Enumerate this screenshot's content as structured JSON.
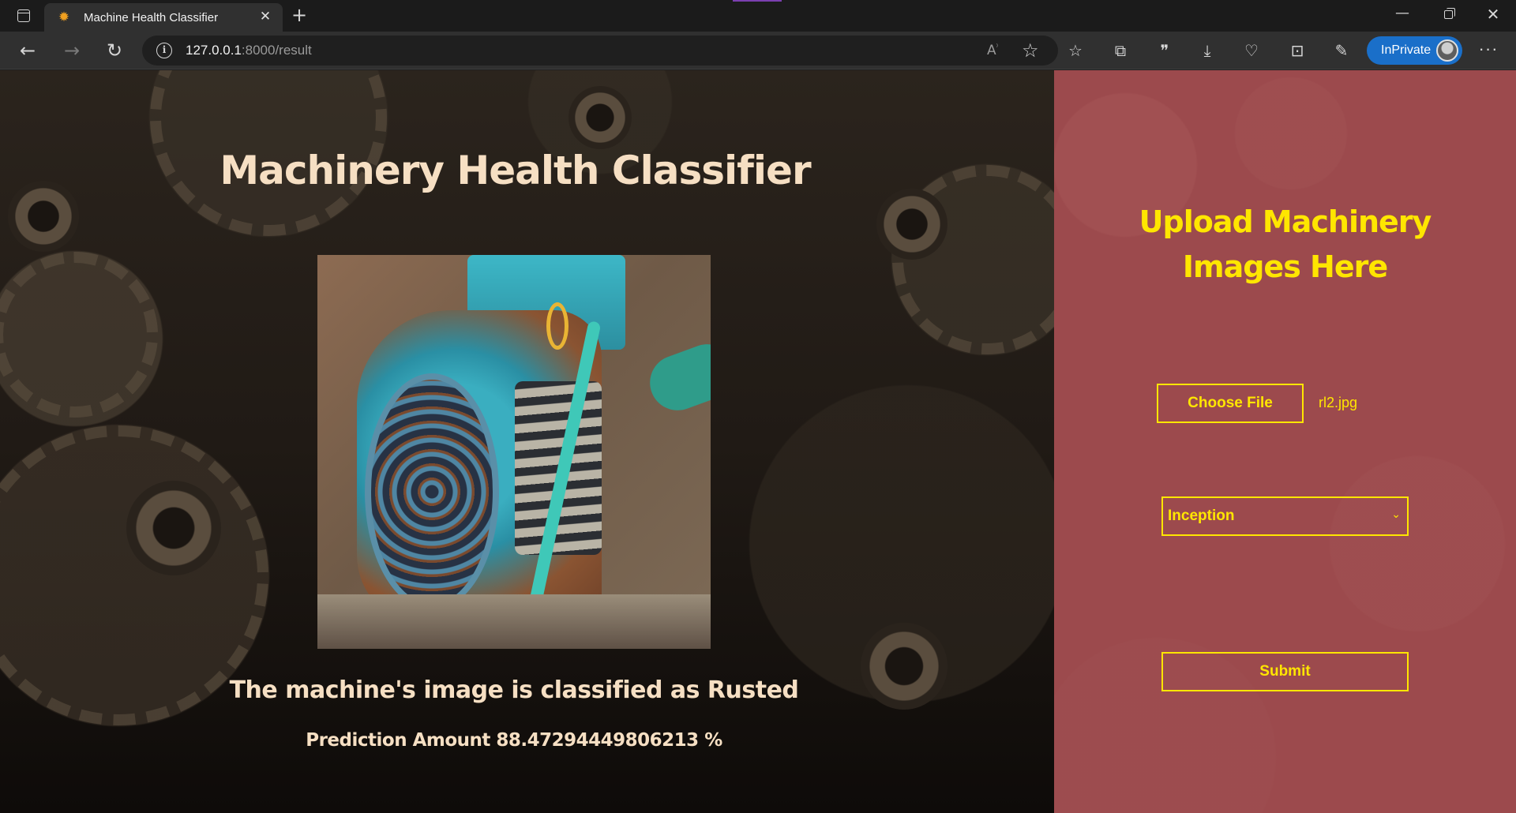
{
  "browser": {
    "tab": {
      "title": "Machine Health Classifier",
      "favicon": "gear-favicon-icon"
    },
    "address": {
      "host": "127.0.0.1",
      "rest": ":8000/result"
    },
    "inprivate_label": "InPrivate",
    "icons": [
      "sidebar-icon",
      "close-icon",
      "plus-icon",
      "back-icon",
      "forward-icon",
      "reload-icon",
      "info-icon",
      "read-aloud-icon",
      "add-favorite-icon",
      "favorites-icon",
      "collections-icon",
      "quote-icon",
      "download-icon",
      "health-icon",
      "math-solver-icon",
      "copilot-icon",
      "more-icon"
    ]
  },
  "page": {
    "title": "Machinery Health Classifier",
    "result_text": "The machine's image is classified as Rusted",
    "prediction_text": "Prediction Amount 88.47294449806213 %",
    "image_subject": "rusted blue electric motor"
  },
  "upload": {
    "heading_line1": "Upload Machinery",
    "heading_line2": "Images Here",
    "choose_file_label": "Choose File",
    "file_name": "rl2.jpg",
    "model_selected": "Inception",
    "submit_label": "Submit"
  },
  "colors": {
    "accent_yellow": "#ffe600",
    "panel_red": "#9c4a4d",
    "title_cream": "#f6dfc3",
    "inprivate_blue": "#1a6fc9"
  }
}
